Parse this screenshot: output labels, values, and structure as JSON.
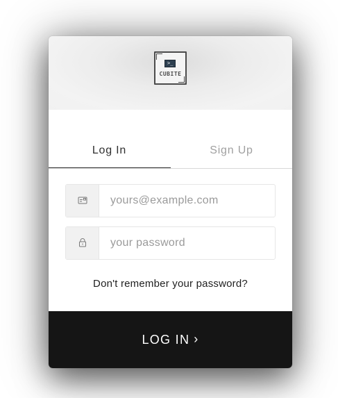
{
  "header": {
    "logo_text": "CUBITE",
    "logo_prompt": ">_"
  },
  "tabs": [
    {
      "label": "Log In",
      "active": true
    },
    {
      "label": "Sign Up",
      "active": false
    }
  ],
  "form": {
    "email": {
      "placeholder": "yours@example.com",
      "value": "",
      "icon": "email-icon"
    },
    "password": {
      "placeholder": "your password",
      "value": "",
      "icon": "lock-icon"
    },
    "forgot_label": "Don't remember your password?",
    "submit_label": "LOG IN",
    "submit_icon": "chevron-right-icon"
  },
  "colors": {
    "header_background": "#f1f1f1",
    "submit_background": "#151515",
    "active_tab": "#2f2f2f",
    "inactive_tab": "#a0a0a0"
  }
}
